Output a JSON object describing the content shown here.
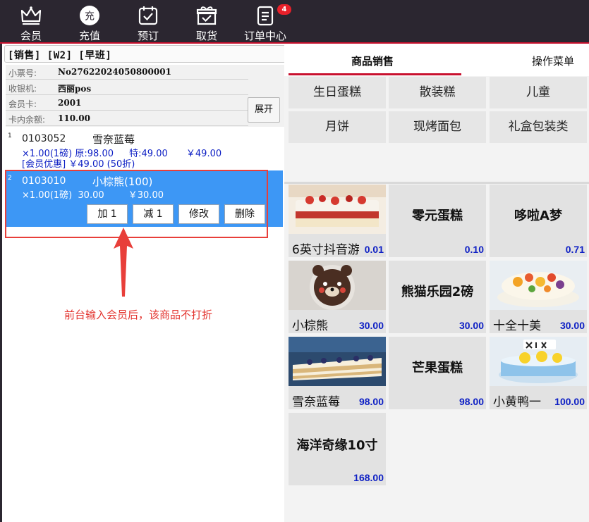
{
  "toolbar": {
    "items": [
      {
        "label": "会员",
        "icon": "crown-icon"
      },
      {
        "label": "充值",
        "icon": "recharge-icon",
        "icon_text": "充"
      },
      {
        "label": "预订",
        "icon": "calendar-check-icon"
      },
      {
        "label": "取货",
        "icon": "gift-box-icon"
      },
      {
        "label": "订单中心",
        "icon": "order-list-icon"
      }
    ],
    "order_badge": "4"
  },
  "mode_header": "[销售] [W2] [早班]",
  "info": {
    "receipt_label": "小票号:",
    "receipt_value": "No27622024050800001",
    "cashier_label": "收银机:",
    "cashier_value": "西丽pos",
    "member_label": "会员卡:",
    "member_value": "2001",
    "balance_label": "卡内余额:",
    "balance_value": "110.00",
    "expand_label": "展开"
  },
  "order_lines": [
    {
      "index": "1",
      "code": "0103052",
      "name": "雪奈蓝莓",
      "qty": "×1.00(1磅)",
      "original": "原:98.00",
      "special": "特:49.00",
      "amount": "￥49.00",
      "promo": "[会员优惠] ￥49.00 (50折)"
    },
    {
      "index": "2",
      "code": "0103010",
      "name": "小棕熊(100)",
      "qty": "×1.00(1磅)",
      "price": "30.00",
      "amount": "￥30.00",
      "actions": {
        "add": "加 1",
        "sub": "减 1",
        "edit": "修改",
        "delete": "删除"
      }
    }
  ],
  "annotation_note": "前台输入会员后，该商品不打折",
  "colors": {
    "toolbar_bg": "#2b2630",
    "accent_red": "#c8102e",
    "selected_row": "#3d97f5",
    "price_blue": "#0d1fc4",
    "annotation_red": "#e3342f"
  },
  "tabs": {
    "sales": "商品销售",
    "menu": "操作菜单"
  },
  "categories": [
    "生日蛋糕",
    "散装糕",
    "儿童",
    "月饼",
    "现烤面包",
    "礼盒包装类"
  ],
  "products": [
    {
      "name": "6英寸抖音游",
      "price": "0.01",
      "has_image": true
    },
    {
      "name": "零元蛋糕",
      "price": "0.10",
      "has_image": false
    },
    {
      "name": "哆啦A梦",
      "price": "0.71",
      "has_image": false
    },
    {
      "name": "小棕熊",
      "price": "30.00",
      "has_image": true
    },
    {
      "name": "熊猫乐园2磅",
      "price": "30.00",
      "has_image": false
    },
    {
      "name": "十全十美",
      "price": "30.00",
      "has_image": true
    },
    {
      "name": "雪奈蓝莓",
      "price": "98.00",
      "has_image": true
    },
    {
      "name": "芒果蛋糕",
      "price": "98.00",
      "has_image": false
    },
    {
      "name": "小黄鸭一",
      "price": "100.00",
      "has_image": true
    },
    {
      "name": "海洋奇缘10寸",
      "price": "168.00",
      "has_image": false
    }
  ]
}
